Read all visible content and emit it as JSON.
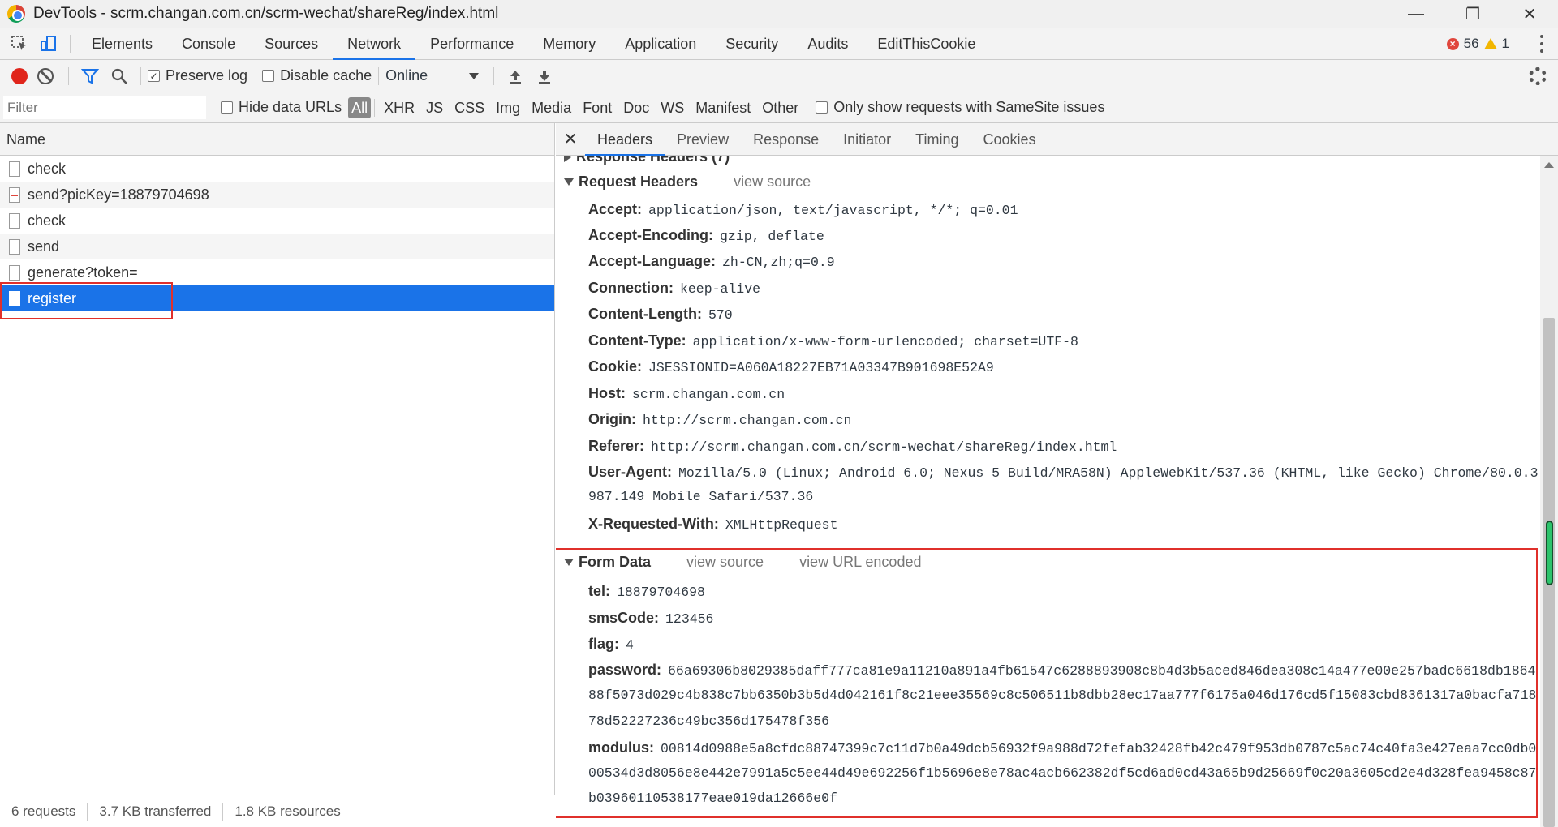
{
  "window": {
    "title": "DevTools - scrm.changan.com.cn/scrm-wechat/shareReg/index.html"
  },
  "main_tabs": [
    "Elements",
    "Console",
    "Sources",
    "Network",
    "Performance",
    "Memory",
    "Application",
    "Security",
    "Audits",
    "EditThisCookie"
  ],
  "active_main_tab": "Network",
  "issues": {
    "errors": "56",
    "warnings": "1"
  },
  "toolbar": {
    "preserve_log": "Preserve log",
    "disable_cache": "Disable cache",
    "throttle": "Online"
  },
  "filterbar": {
    "placeholder": "Filter",
    "hide_data_urls": "Hide data URLs",
    "types": [
      "All",
      "XHR",
      "JS",
      "CSS",
      "Img",
      "Media",
      "Font",
      "Doc",
      "WS",
      "Manifest",
      "Other"
    ],
    "samesite": "Only show requests with SameSite issues"
  },
  "requests": {
    "header": "Name",
    "items": [
      "check",
      "send?picKey=18879704698",
      "check",
      "send",
      "generate?token=",
      "register"
    ]
  },
  "status": {
    "requests": "6 requests",
    "transferred": "3.7 KB transferred",
    "resources": "1.8 KB resources"
  },
  "detail_tabs": [
    "Headers",
    "Preview",
    "Response",
    "Initiator",
    "Timing",
    "Cookies"
  ],
  "response_headers_label": "Response Headers (7)",
  "request_headers": {
    "title": "Request Headers",
    "view_source": "view source",
    "rows": [
      {
        "k": "Accept:",
        "v": "application/json, text/javascript, */*; q=0.01"
      },
      {
        "k": "Accept-Encoding:",
        "v": "gzip, deflate"
      },
      {
        "k": "Accept-Language:",
        "v": "zh-CN,zh;q=0.9"
      },
      {
        "k": "Connection:",
        "v": "keep-alive"
      },
      {
        "k": "Content-Length:",
        "v": "570"
      },
      {
        "k": "Content-Type:",
        "v": "application/x-www-form-urlencoded; charset=UTF-8"
      },
      {
        "k": "Cookie:",
        "v": "JSESSIONID=A060A18227EB71A03347B901698E52A9"
      },
      {
        "k": "Host:",
        "v": "scrm.changan.com.cn"
      },
      {
        "k": "Origin:",
        "v": "http://scrm.changan.com.cn"
      },
      {
        "k": "Referer:",
        "v": "http://scrm.changan.com.cn/scrm-wechat/shareReg/index.html"
      },
      {
        "k": "User-Agent:",
        "v": "Mozilla/5.0 (Linux; Android 6.0; Nexus 5 Build/MRA58N) AppleWebKit/537.36 (KHTML, like Gecko) Chrome/80.0.3"
      },
      {
        "k": "X-Requested-With:",
        "v": "XMLHttpRequest"
      }
    ],
    "ua_cont": "987.149 Mobile Safari/537.36"
  },
  "form_data": {
    "title": "Form Data",
    "view_source": "view source",
    "view_url_encoded": "view URL encoded",
    "tel_k": "tel:",
    "tel_v": "18879704698",
    "sms_k": "smsCode:",
    "sms_v": "123456",
    "flag_k": "flag:",
    "flag_v": "4",
    "pw_k": "password:",
    "pw_v1": "66a69306b8029385daff777ca81e9a11210a891a4fb61547c6288893908c8b4d3b5aced846dea308c14a477e00e257badc6618db1864",
    "pw_v2": "88f5073d029c4b838c7bb6350b3b5d4d042161f8c21eee35569c8c506511b8dbb28ec17aa777f6175a046d176cd5f15083cbd8361317a0bacfa718",
    "pw_v3": "78d52227236c49bc356d175478f356",
    "mod_k": "modulus:",
    "mod_v1": "00814d0988e5a8cfdc88747399c7c11d7b0a49dcb56932f9a988d72fefab32428fb42c479f953db0787c5ac74c40fa3e427eaa7cc0db0",
    "mod_v2": "00534d3d8056e8e442e7991a5c5ee44d49e692256f1b5696e8e78ac4acb662382df5cd6ad0cd43a65b9d25669f0c20a3605cd2e4d328fea9458c87",
    "mod_v3": "b03960110538177eae019da12666e0f"
  }
}
